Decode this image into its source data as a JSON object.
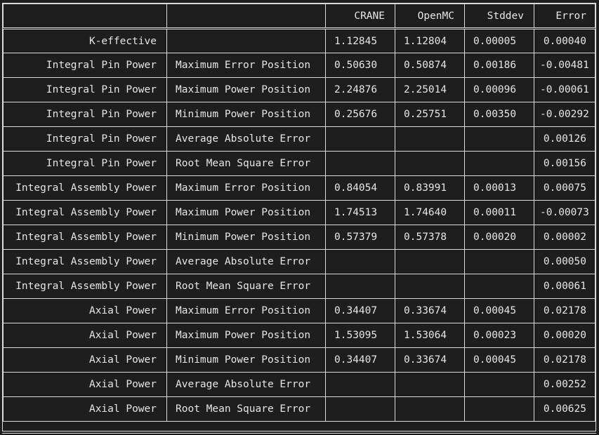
{
  "table": {
    "headers": [
      "",
      "",
      "CRANE",
      "OpenMC",
      "Stddev",
      "Error"
    ],
    "rows": [
      {
        "quantity": "K-effective",
        "location": "",
        "crane": "1.12845",
        "openmc": "1.12804",
        "stddev": "0.00005",
        "error": "0.00040"
      },
      {
        "quantity": "Integral Pin Power",
        "location": "Maximum Error Position",
        "crane": "0.50630",
        "openmc": "0.50874",
        "stddev": "0.00186",
        "error": "-0.00481"
      },
      {
        "quantity": "Integral Pin Power",
        "location": "Maximum Power Position",
        "crane": "2.24876",
        "openmc": "2.25014",
        "stddev": "0.00096",
        "error": "-0.00061"
      },
      {
        "quantity": "Integral Pin Power",
        "location": "Minimum Power Position",
        "crane": "0.25676",
        "openmc": "0.25751",
        "stddev": "0.00350",
        "error": "-0.00292"
      },
      {
        "quantity": "Integral Pin Power",
        "location": "Average Absolute Error",
        "crane": "",
        "openmc": "",
        "stddev": "",
        "error": "0.00126"
      },
      {
        "quantity": "Integral Pin Power",
        "location": "Root Mean Square Error",
        "crane": "",
        "openmc": "",
        "stddev": "",
        "error": "0.00156"
      },
      {
        "quantity": "Integral Assembly Power",
        "location": "Maximum Error Position",
        "crane": "0.84054",
        "openmc": "0.83991",
        "stddev": "0.00013",
        "error": "0.00075"
      },
      {
        "quantity": "Integral Assembly Power",
        "location": "Maximum Power Position",
        "crane": "1.74513",
        "openmc": "1.74640",
        "stddev": "0.00011",
        "error": "-0.00073"
      },
      {
        "quantity": "Integral Assembly Power",
        "location": "Minimum Power Position",
        "crane": "0.57379",
        "openmc": "0.57378",
        "stddev": "0.00020",
        "error": "0.00002"
      },
      {
        "quantity": "Integral Assembly Power",
        "location": "Average Absolute Error",
        "crane": "",
        "openmc": "",
        "stddev": "",
        "error": "0.00050"
      },
      {
        "quantity": "Integral Assembly Power",
        "location": "Root Mean Square Error",
        "crane": "",
        "openmc": "",
        "stddev": "",
        "error": "0.00061"
      },
      {
        "quantity": "Axial Power",
        "location": "Maximum Error Position",
        "crane": "0.34407",
        "openmc": "0.33674",
        "stddev": "0.00045",
        "error": "0.02178"
      },
      {
        "quantity": "Axial Power",
        "location": "Maximum Power Position",
        "crane": "1.53095",
        "openmc": "1.53064",
        "stddev": "0.00023",
        "error": "0.00020"
      },
      {
        "quantity": "Axial Power",
        "location": "Minimum Power Position",
        "crane": "0.34407",
        "openmc": "0.33674",
        "stddev": "0.00045",
        "error": "0.02178"
      },
      {
        "quantity": "Axial Power",
        "location": "Average Absolute Error",
        "crane": "",
        "openmc": "",
        "stddev": "",
        "error": "0.00252"
      },
      {
        "quantity": "Axial Power",
        "location": "Root Mean Square Error",
        "crane": "",
        "openmc": "",
        "stddev": "",
        "error": "0.00625"
      }
    ]
  }
}
